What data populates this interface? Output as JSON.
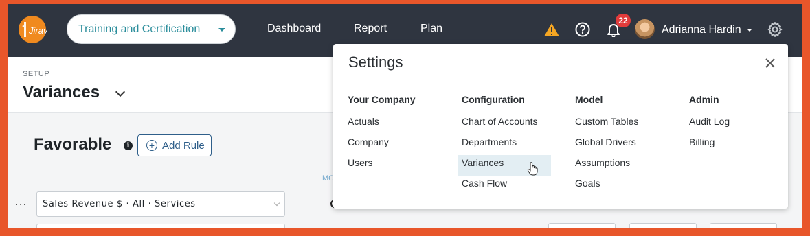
{
  "brand": {
    "name": "Jirav",
    "color": "#f08a1f"
  },
  "topbar": {
    "selector_label": "Training and Certification",
    "nav": [
      "Dashboard",
      "Report",
      "Plan"
    ],
    "notification_count": "22",
    "user_name": "Adrianna Hardin",
    "icons": [
      "warning-icon",
      "help-icon",
      "bell-icon",
      "gear-icon"
    ]
  },
  "page": {
    "section": "SETUP",
    "title": "Variances",
    "favorable_heading": "Favorable",
    "add_rule_label": "Add Rule",
    "column_header_partial": "MO",
    "row_actions": "···",
    "row_select_value": "Sales Revenue $ · All · Services"
  },
  "settings": {
    "title": "Settings",
    "columns": [
      {
        "heading": "Your Company",
        "items": [
          "Actuals",
          "Company",
          "Users"
        ]
      },
      {
        "heading": "Configuration",
        "items": [
          "Chart of Accounts",
          "Departments",
          "Variances",
          "Cash Flow"
        ]
      },
      {
        "heading": "Model",
        "items": [
          "Custom Tables",
          "Global Drivers",
          "Assumptions",
          "Goals"
        ]
      },
      {
        "heading": "Admin",
        "items": [
          "Audit Log",
          "Billing"
        ]
      }
    ],
    "highlighted_item": "Variances"
  },
  "colors": {
    "accent": "#e8562a",
    "topbar": "#2f3540",
    "link": "#2a8d9b",
    "warning": "#f5a623",
    "badge": "#e23b3b"
  }
}
